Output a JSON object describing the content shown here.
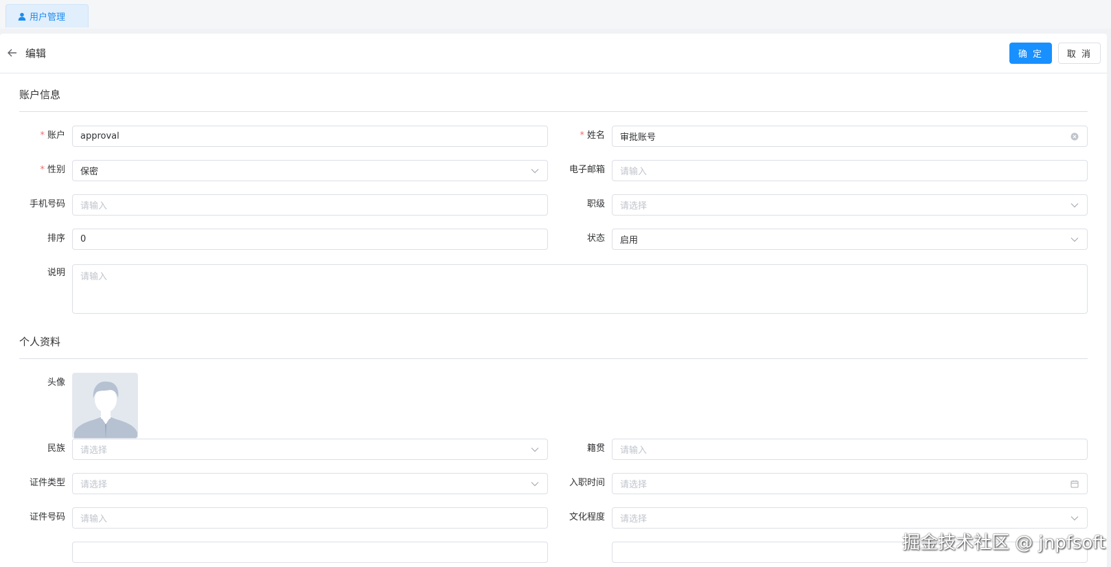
{
  "tabs": [
    {
      "label": "用户管理",
      "icon": "user-icon"
    }
  ],
  "header": {
    "title": "编辑",
    "confirm_label": "确 定",
    "cancel_label": "取 消"
  },
  "sections": {
    "account": "账户信息",
    "profile": "个人资料"
  },
  "account": {
    "account": {
      "label": "账户",
      "value": "approval"
    },
    "name": {
      "label": "姓名",
      "value": "审批账号"
    },
    "gender": {
      "label": "性别",
      "value": "保密"
    },
    "email": {
      "label": "电子邮箱",
      "placeholder": "请输入"
    },
    "phone": {
      "label": "手机号码",
      "placeholder": "请输入"
    },
    "rank": {
      "label": "职级",
      "placeholder": "请选择"
    },
    "sort": {
      "label": "排序",
      "value": "0"
    },
    "status": {
      "label": "状态",
      "value": "启用"
    },
    "desc": {
      "label": "说明",
      "placeholder": "请输入"
    }
  },
  "profile": {
    "avatar": {
      "label": "头像"
    },
    "ethnicity": {
      "label": "民族",
      "placeholder": "请选择"
    },
    "native_place": {
      "label": "籍贯",
      "placeholder": "请输入"
    },
    "id_type": {
      "label": "证件类型",
      "placeholder": "请选择"
    },
    "entry_date": {
      "label": "入职时间",
      "placeholder": "请选择"
    },
    "id_number": {
      "label": "证件号码",
      "placeholder": "请输入"
    },
    "education": {
      "label": "文化程度",
      "placeholder": "请选择"
    }
  },
  "watermark": "掘金技术社区 @ jnpfsoft",
  "colors": {
    "primary": "#1890ff",
    "required": "#f56c6c",
    "placeholder": "#c0c4cc",
    "border": "#dcdfe6"
  }
}
